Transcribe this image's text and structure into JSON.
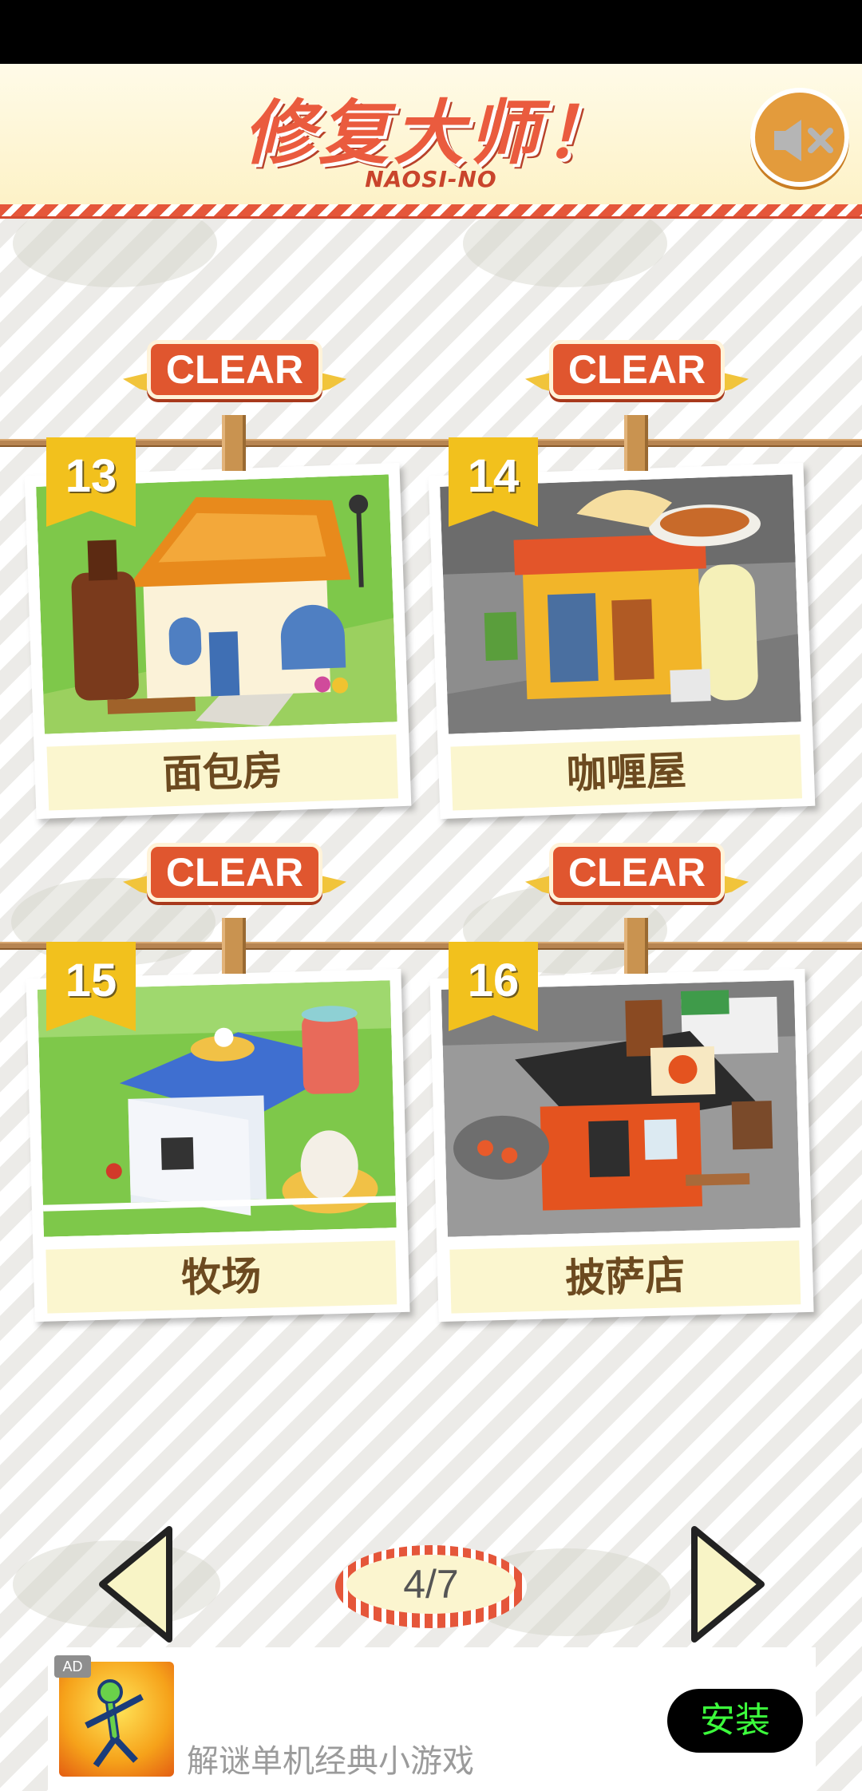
{
  "header": {
    "title": "修复大师！",
    "subtitle": "NAOSI-NO",
    "mute_icon": "speaker-muted-icon"
  },
  "levels": [
    {
      "number": "13",
      "name": "面包房",
      "badge": "CLEAR"
    },
    {
      "number": "14",
      "name": "咖喱屋",
      "badge": "CLEAR"
    },
    {
      "number": "15",
      "name": "牧场",
      "badge": "CLEAR"
    },
    {
      "number": "16",
      "name": "披萨店",
      "badge": "CLEAR"
    }
  ],
  "pagination": {
    "label": "4/7",
    "prev_icon": "triangle-left-icon",
    "next_icon": "triangle-right-icon"
  },
  "ad": {
    "tag": "AD",
    "text": "解谜单机经典小游戏",
    "install_label": "安装"
  },
  "colors": {
    "accent": "#e0562f",
    "badge": "#f2c11d",
    "strip": "#fbf6cf"
  }
}
